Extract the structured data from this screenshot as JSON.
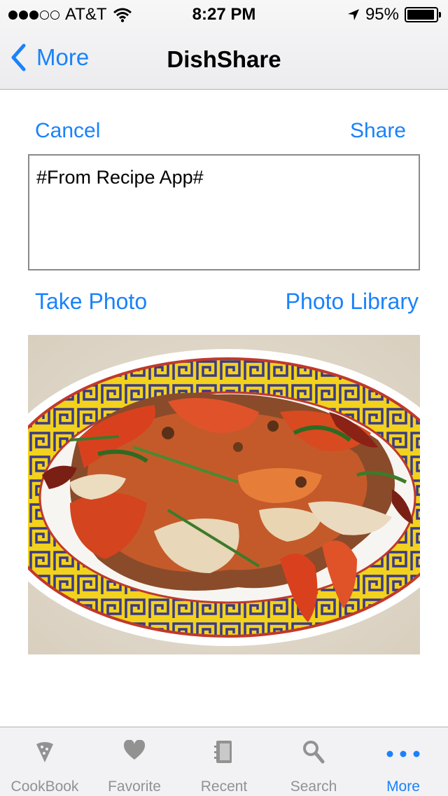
{
  "status_bar": {
    "carrier": "AT&T",
    "time": "8:27 PM",
    "battery": "95%",
    "signal_bars_filled": 3,
    "signal_bars_total": 5,
    "battery_level": 0.95
  },
  "nav": {
    "back_label": "More",
    "title": "DishShare"
  },
  "compose": {
    "cancel_label": "Cancel",
    "share_label": "Share",
    "text_value": "#From Recipe App#",
    "take_photo_label": "Take Photo",
    "photo_library_label": "Photo Library"
  },
  "tabs": [
    {
      "label": "CookBook",
      "icon": "cookbook-icon",
      "active": false
    },
    {
      "label": "Favorite",
      "icon": "heart-icon",
      "active": false
    },
    {
      "label": "Recent",
      "icon": "notebook-icon",
      "active": false
    },
    {
      "label": "Search",
      "icon": "search-icon",
      "active": false
    },
    {
      "label": "More",
      "icon": "more-dots-icon",
      "active": true
    }
  ],
  "colors": {
    "accent": "#1a82fb",
    "tab_inactive": "#929292"
  }
}
